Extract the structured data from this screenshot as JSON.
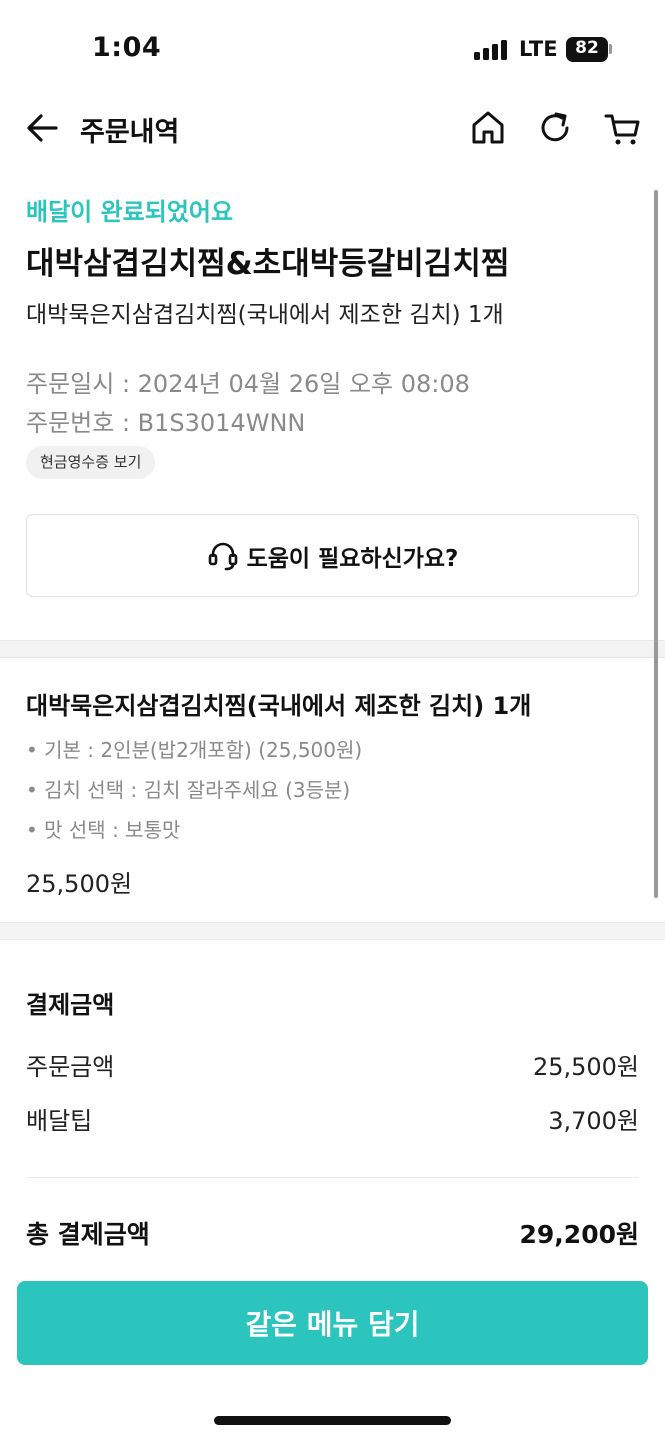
{
  "status_bar": {
    "time": "1:04",
    "network": "LTE",
    "battery": "82"
  },
  "header": {
    "title": "주문내역",
    "back_icon": "arrow-left-icon",
    "icons": [
      "home-icon",
      "refresh-icon",
      "cart-icon"
    ]
  },
  "order": {
    "status": "배달이 완료되었어요",
    "store_name": "대박삼겹김치찜&초대박등갈비김치찜",
    "summary": "대박묵은지삼겹김치찜(국내에서 제조한 김치) 1개",
    "order_datetime": "주문일시 : 2024년 04월 26일 오후 08:08",
    "order_number": "주문번호 : B1S3014WNN",
    "receipt_button": "현금영수증 보기",
    "help_button": "도움이 필요하신가요?",
    "help_icon": "headset-icon"
  },
  "item": {
    "name": "대박묵은지삼겹김치찜(국내에서 제조한 김치) 1개",
    "options": [
      "• 기본 : 2인분(밥2개포함) (25,500원)",
      "• 김치 선택 : 김치 잘라주세요 (3등분)",
      "• 맛 선택 : 보통맛"
    ],
    "price": "25,500원"
  },
  "payment": {
    "title": "결제금액",
    "rows": [
      {
        "label": "주문금액",
        "value": "25,500원"
      },
      {
        "label": "배달팁",
        "value": "3,700원"
      }
    ],
    "total_label": "총 결제금액",
    "total_value": "29,200원"
  },
  "cta": {
    "label": "같은 메뉴 담기"
  },
  "colors": {
    "accent": "#2cc5bd"
  }
}
